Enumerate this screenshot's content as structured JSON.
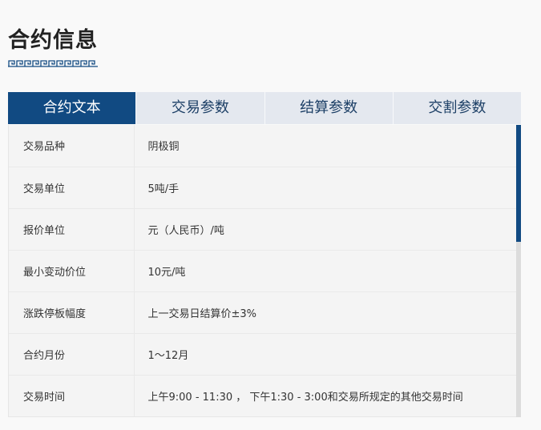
{
  "page": {
    "title": "合约信息"
  },
  "tabs": [
    {
      "label": "合约文本",
      "active": true
    },
    {
      "label": "交易参数",
      "active": false
    },
    {
      "label": "结算参数",
      "active": false
    },
    {
      "label": "交割参数",
      "active": false
    }
  ],
  "contract": {
    "rows": [
      {
        "label": "交易品种",
        "value": "阴极铜"
      },
      {
        "label": "交易单位",
        "value": "5吨/手"
      },
      {
        "label": "报价单位",
        "value": "元（人民币）/吨"
      },
      {
        "label": "最小变动价位",
        "value": "10元/吨"
      },
      {
        "label": "涨跌停板幅度",
        "value": "上一交易日结算价±3%"
      },
      {
        "label": "合约月份",
        "value": "1～12月"
      },
      {
        "label": "交易时间",
        "value": "上午9:00 - 11:30 ， 下午1:30 - 3:00和交易所规定的其他交易时间"
      }
    ]
  },
  "colors": {
    "accent": "#114a82",
    "tab_inactive_bg": "#e4e8ef",
    "tab_inactive_text": "#1c3f66",
    "table_bg": "#f4f4f4"
  },
  "scroll": {
    "position_fraction": 0.0,
    "visible_fraction": 0.4
  }
}
